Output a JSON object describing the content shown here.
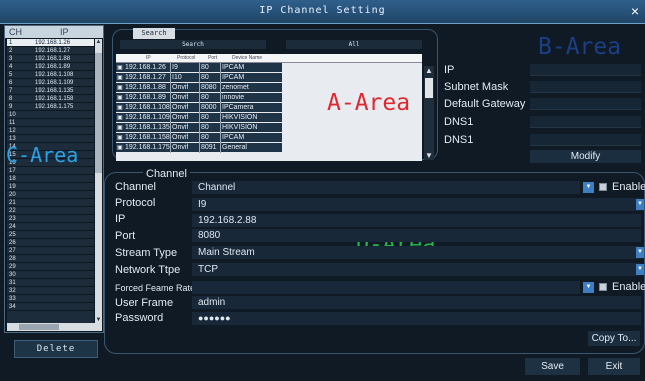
{
  "window": {
    "title": "IP Channel Setting",
    "close_glyph": "×"
  },
  "channel_list": {
    "headers": {
      "ch": "CH",
      "ip": "IP"
    },
    "rows": [
      {
        "ch": "1",
        "ip": "192.168.1.26",
        "selected": true
      },
      {
        "ch": "2",
        "ip": "192.168.1.27"
      },
      {
        "ch": "3",
        "ip": "192.168.1.88"
      },
      {
        "ch": "4",
        "ip": "192.168.1.89"
      },
      {
        "ch": "5",
        "ip": "192.168.1.108"
      },
      {
        "ch": "6",
        "ip": "192.168.1.109"
      },
      {
        "ch": "7",
        "ip": "192.168.1.135"
      },
      {
        "ch": "8",
        "ip": "192.168.1.158"
      },
      {
        "ch": "9",
        "ip": "192.168.1.175"
      },
      {
        "ch": "10",
        "ip": ""
      },
      {
        "ch": "11",
        "ip": ""
      },
      {
        "ch": "12",
        "ip": ""
      },
      {
        "ch": "13",
        "ip": ""
      },
      {
        "ch": "14",
        "ip": ""
      },
      {
        "ch": "15",
        "ip": ""
      },
      {
        "ch": "16",
        "ip": ""
      },
      {
        "ch": "17",
        "ip": ""
      },
      {
        "ch": "18",
        "ip": ""
      },
      {
        "ch": "19",
        "ip": ""
      },
      {
        "ch": "20",
        "ip": ""
      },
      {
        "ch": "21",
        "ip": ""
      },
      {
        "ch": "22",
        "ip": ""
      },
      {
        "ch": "23",
        "ip": ""
      },
      {
        "ch": "24",
        "ip": ""
      },
      {
        "ch": "25",
        "ip": ""
      },
      {
        "ch": "26",
        "ip": ""
      },
      {
        "ch": "27",
        "ip": ""
      },
      {
        "ch": "28",
        "ip": ""
      },
      {
        "ch": "29",
        "ip": ""
      },
      {
        "ch": "30",
        "ip": ""
      },
      {
        "ch": "31",
        "ip": ""
      },
      {
        "ch": "32",
        "ip": ""
      },
      {
        "ch": "33",
        "ip": ""
      },
      {
        "ch": "34",
        "ip": ""
      }
    ],
    "area_label": "C-Area",
    "delete_label": "Delete"
  },
  "search": {
    "tab_label": "Search",
    "search_bar": "Search",
    "all_bar": "All",
    "table_headers": {
      "ip": "IP",
      "protocol": "Protocol",
      "port": "Port",
      "device_name": "Device Name"
    },
    "devices": [
      {
        "ip": "192.168.1.26",
        "protocol": "I9",
        "port": "80",
        "name": "IPCAM"
      },
      {
        "ip": "192.168.1.27",
        "protocol": "I10",
        "port": "80",
        "name": "IPCAM"
      },
      {
        "ip": "192.168.1.88",
        "protocol": "Onvif",
        "port": "8080",
        "name": "zenomet"
      },
      {
        "ip": "192.168.1.89",
        "protocol": "Onvif",
        "port": "80",
        "name": "innovie"
      },
      {
        "ip": "192.168.1.108",
        "protocol": "Onvif",
        "port": "8000",
        "name": "IPCamera"
      },
      {
        "ip": "192.168.1.109",
        "protocol": "Onvif",
        "port": "80",
        "name": "HIKVISION"
      },
      {
        "ip": "192.168.1.135",
        "protocol": "Onvif",
        "port": "80",
        "name": "HIKVISION"
      },
      {
        "ip": "192.168.1.158",
        "protocol": "Onvif",
        "port": "80",
        "name": "IPCAM"
      },
      {
        "ip": "192.168.1.175",
        "protocol": "Onvif",
        "port": "8091",
        "name": "General"
      }
    ],
    "area_label": "A-Area"
  },
  "network": {
    "area_label": "B-Area",
    "labels": [
      "IP",
      "Subnet Mask",
      "Default Gateway",
      "DNS1",
      "DNS1"
    ],
    "modify_label": "Modify"
  },
  "channel_settings": {
    "legend": "Channel",
    "area_label": "D-Area",
    "labels": {
      "channel": "Channel",
      "protocol": "Protocol",
      "ip": "IP",
      "port": "Port",
      "stream_type": "Stream Type",
      "network_type": "Network Ttpe",
      "forced_frame_rate": "Forced Feame Rate",
      "user_frame": "User Frame",
      "password": "Password"
    },
    "values": {
      "channel": "Channel",
      "protocol": "I9",
      "ip": "192.168.2.88",
      "port": "8080",
      "stream_type": "Main Stream",
      "network_type": "TCP",
      "forced_frame_rate": "",
      "user_frame": "admin",
      "password": "●●●●●●"
    },
    "enable_label": "Enable",
    "enable_label_2": "Enable",
    "copy_label": "Copy To..."
  },
  "footer": {
    "save_label": "Save",
    "exit_label": "Exit"
  },
  "colors": {
    "a_area": "#e0262e",
    "b_area": "#1b3f86",
    "c_area": "#2aa2e8",
    "d_area": "#22b54a"
  }
}
